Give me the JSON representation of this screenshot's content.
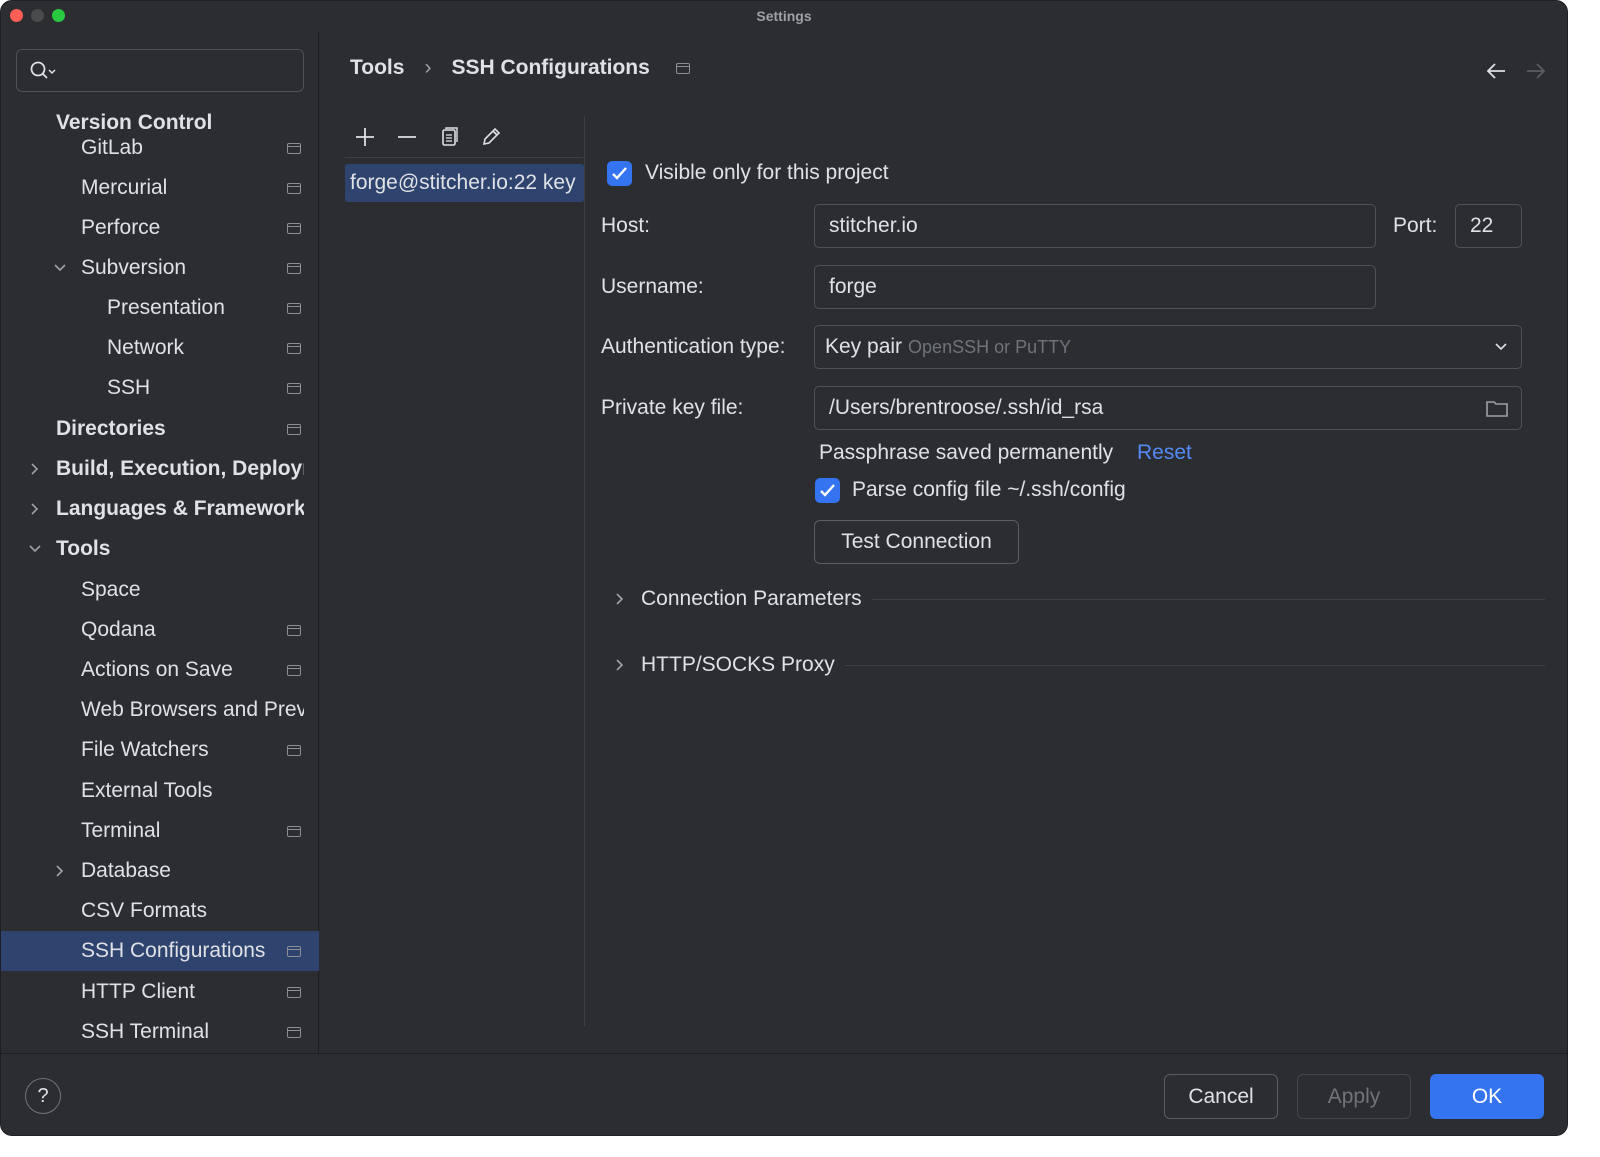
{
  "window": {
    "title": "Settings"
  },
  "sidebar": {
    "search_placeholder": "",
    "items": [
      {
        "label": "Version Control",
        "bold": true
      },
      {
        "label": "GitLab",
        "pin": true
      },
      {
        "label": "Mercurial",
        "pin": true
      },
      {
        "label": "Perforce",
        "pin": true
      },
      {
        "label": "Subversion",
        "pin": true,
        "expanded": true
      },
      {
        "label": "Presentation",
        "pin": true
      },
      {
        "label": "Network",
        "pin": true
      },
      {
        "label": "SSH",
        "pin": true
      },
      {
        "label": "Directories",
        "bold": true,
        "pin": true
      },
      {
        "label": "Build, Execution, Deployment",
        "bold": true,
        "collapsed": true
      },
      {
        "label": "Languages & Frameworks",
        "bold": true,
        "collapsed": true
      },
      {
        "label": "Tools",
        "bold": true,
        "expanded": true
      },
      {
        "label": "Space"
      },
      {
        "label": "Qodana",
        "pin": true
      },
      {
        "label": "Actions on Save",
        "pin": true
      },
      {
        "label": "Web Browsers and Preview"
      },
      {
        "label": "File Watchers",
        "pin": true
      },
      {
        "label": "External Tools"
      },
      {
        "label": "Terminal",
        "pin": true
      },
      {
        "label": "Database",
        "collapsed": true
      },
      {
        "label": "CSV Formats"
      },
      {
        "label": "SSH Configurations",
        "pin": true,
        "selected": true
      },
      {
        "label": "HTTP Client",
        "pin": true
      },
      {
        "label": "SSH Terminal",
        "pin": true
      }
    ]
  },
  "breadcrumb": {
    "parent": "Tools",
    "current": "SSH Configurations"
  },
  "config_list": {
    "entries": [
      "forge@stitcher.io:22 key"
    ]
  },
  "form": {
    "visible_only_label": "Visible only for this project",
    "visible_only_checked": true,
    "host_label": "Host:",
    "host_value": "stitcher.io",
    "port_label": "Port:",
    "port_value": "22",
    "username_label": "Username:",
    "username_value": "forge",
    "auth_label": "Authentication type:",
    "auth_value": "Key pair",
    "auth_hint": "OpenSSH or PuTTY",
    "key_label": "Private key file:",
    "key_value": "/Users/brentroose/.ssh/id_rsa",
    "passphrase_text": "Passphrase saved permanently",
    "reset_link": "Reset",
    "parse_config_label": "Parse config file ~/.ssh/config",
    "parse_config_checked": true,
    "test_button": "Test Connection",
    "section_connection": "Connection Parameters",
    "section_proxy": "HTTP/SOCKS Proxy"
  },
  "footer": {
    "help": "?",
    "cancel": "Cancel",
    "apply": "Apply",
    "ok": "OK"
  },
  "colors": {
    "accent": "#3574f0",
    "selection": "#2e436e",
    "link": "#548af7",
    "background": "#2b2d30"
  }
}
